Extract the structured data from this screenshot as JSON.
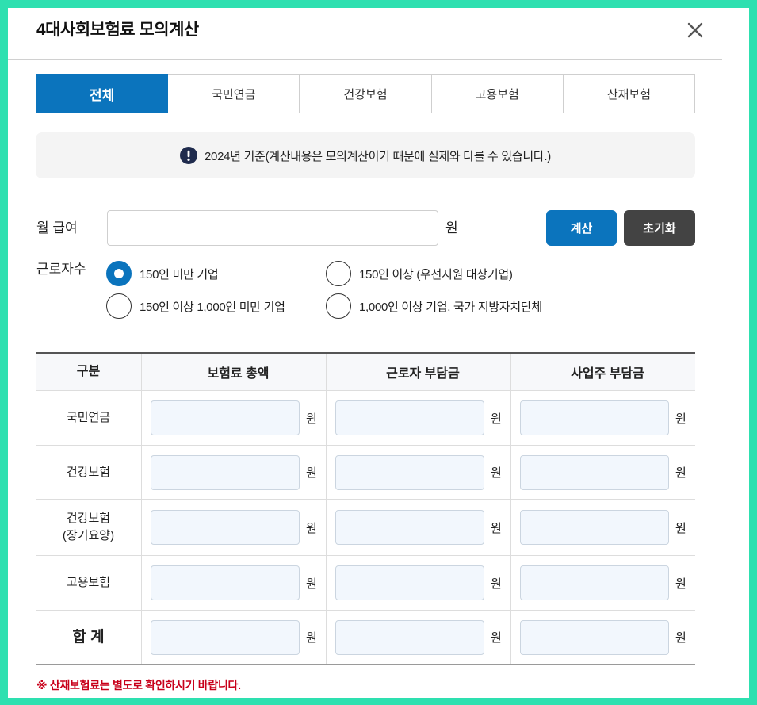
{
  "modal": {
    "title": "4대사회보험료 모의계산",
    "close_icon": "close-icon"
  },
  "tabs": [
    {
      "label": "전체",
      "active": true
    },
    {
      "label": "국민연금",
      "active": false
    },
    {
      "label": "건강보험",
      "active": false
    },
    {
      "label": "고용보험",
      "active": false
    },
    {
      "label": "산재보험",
      "active": false
    }
  ],
  "notice": {
    "icon": "exclamation-circle-icon",
    "text": "2024년 기준(계산내용은 모의계산이기 때문에 실제와 다를 수 있습니다.)"
  },
  "salary": {
    "label": "월 급여",
    "value": "",
    "unit": "원"
  },
  "actions": {
    "calculate": "계산",
    "reset": "초기화"
  },
  "workers": {
    "label": "근로자수",
    "options": [
      {
        "label": "150인 미만 기업",
        "selected": true
      },
      {
        "label": "150인 이상 (우선지원 대상기업)",
        "selected": false
      },
      {
        "label": "150인 이상 1,000인 미만 기업",
        "selected": false
      },
      {
        "label": "1,000인 이상 기업, 국가 지방자치단체",
        "selected": false
      }
    ]
  },
  "table": {
    "headers": [
      "구분",
      "보험료 총액",
      "근로자 부담금",
      "사업주 부담금"
    ],
    "unit": "원",
    "rows": [
      {
        "label": "국민연금",
        "total": "",
        "employee": "",
        "employer": ""
      },
      {
        "label": "건강보험",
        "total": "",
        "employee": "",
        "employer": ""
      },
      {
        "label": "건강보험",
        "sublabel": "(장기요양)",
        "total": "",
        "employee": "",
        "employer": ""
      },
      {
        "label": "고용보험",
        "total": "",
        "employee": "",
        "employer": ""
      },
      {
        "label": "합 계",
        "total": "",
        "employee": "",
        "employer": ""
      }
    ]
  },
  "note": "※ 산재보험료는 별도로 확인하시기 바랍니다.",
  "colors": {
    "frame": "#2ee0b0",
    "accent": "#0b74bd",
    "dark": "#434343",
    "note": "#c8001a",
    "icon": "#1f2b4d"
  }
}
